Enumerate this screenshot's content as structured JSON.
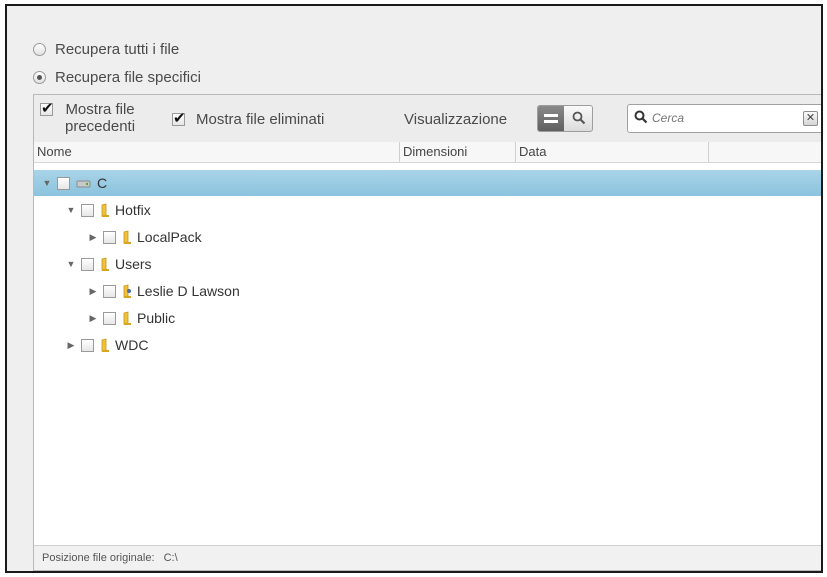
{
  "recovery_options": [
    {
      "label": "Recupera tutti i file",
      "selected": false
    },
    {
      "label": "Recupera file specifici",
      "selected": true
    }
  ],
  "toolbar": {
    "show_previous": {
      "label_line1": "Mostra file",
      "label_line2": "precedenti",
      "checked": true
    },
    "show_deleted": {
      "label": "Mostra file eliminati",
      "checked": true
    },
    "view_label": "Visualizzazione",
    "search_placeholder": "Cerca"
  },
  "columns": {
    "name": "Nome",
    "size": "Dimensioni",
    "date": "Data"
  },
  "tree": [
    {
      "label": "C",
      "level": 0,
      "expanded": true,
      "selected": true,
      "icon": "drive-icon"
    },
    {
      "label": "Hotfix",
      "level": 1,
      "expanded": true,
      "icon": "folder-icon"
    },
    {
      "label": "LocalPack",
      "level": 2,
      "expanded": false,
      "icon": "folder-icon"
    },
    {
      "label": "Users",
      "level": 1,
      "expanded": true,
      "icon": "folder-icon"
    },
    {
      "label": "Leslie D Lawson",
      "level": 2,
      "expanded": false,
      "icon": "user-folder-icon"
    },
    {
      "label": "Public",
      "level": 2,
      "expanded": false,
      "icon": "folder-icon"
    },
    {
      "label": "WDC",
      "level": 1,
      "expanded": false,
      "icon": "folder-icon"
    }
  ],
  "status": {
    "label": "Posizione file originale:",
    "value": "C:\\"
  },
  "colors": {
    "selection": "#8bc3dd",
    "folder": "#e8b930"
  }
}
